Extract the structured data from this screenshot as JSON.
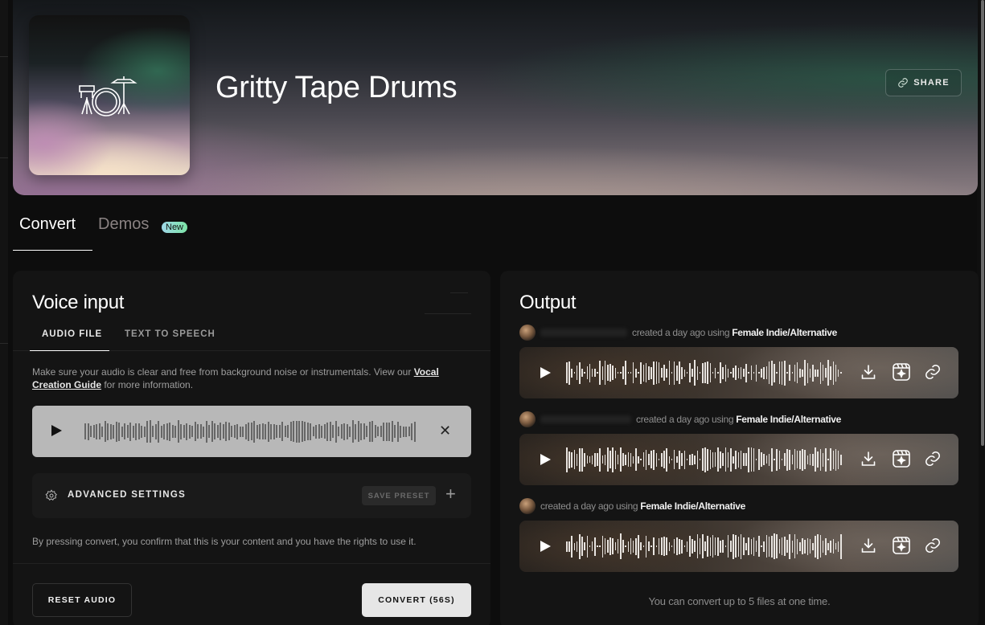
{
  "header": {
    "title": "Gritty Tape Drums",
    "cover_icon": "drum-kit-icon",
    "share_label": "SHARE",
    "share_icon": "link-icon"
  },
  "tabs": [
    {
      "label": "Convert",
      "active": true
    },
    {
      "label": "Demos",
      "active": false,
      "badge": "New"
    }
  ],
  "voice_input": {
    "title": "Voice input",
    "subtabs": [
      {
        "label": "AUDIO FILE",
        "active": true
      },
      {
        "label": "TEXT TO SPEECH",
        "active": false
      }
    ],
    "helper_text": "Make sure your audio is clear and free from background noise or instrumentals. View our ",
    "helper_link": "Vocal Creation Guide",
    "helper_suffix": " for more information.",
    "player": {
      "play_icon": "play-icon",
      "close_icon": "close-icon"
    },
    "advanced_settings_label": "ADVANCED SETTINGS",
    "save_preset_label": "SAVE PRESET",
    "consent_text": "By pressing convert, you confirm that this is your content and you have the rights to use it.",
    "reset_label": "RESET AUDIO",
    "convert_label": "CONVERT (56S)"
  },
  "output": {
    "title": "Output",
    "items": [
      {
        "meta_text": "created a day ago using",
        "model": "Female Indie/Alternative"
      },
      {
        "meta_text": "created a day ago using",
        "model": "Female Indie/Alternative"
      },
      {
        "meta_text": "created a day ago using",
        "model": "Female Indie/Alternative"
      }
    ],
    "actions": [
      "download-icon",
      "video-sparkle-icon",
      "link-icon"
    ],
    "footnote": "You can convert up to 5 files at one time."
  },
  "colors": {
    "accent_badge_start": "#9fd7e8",
    "accent_badge_end": "#7be3a5",
    "panel_bg": "#141414",
    "page_bg": "#0d0d0d"
  }
}
